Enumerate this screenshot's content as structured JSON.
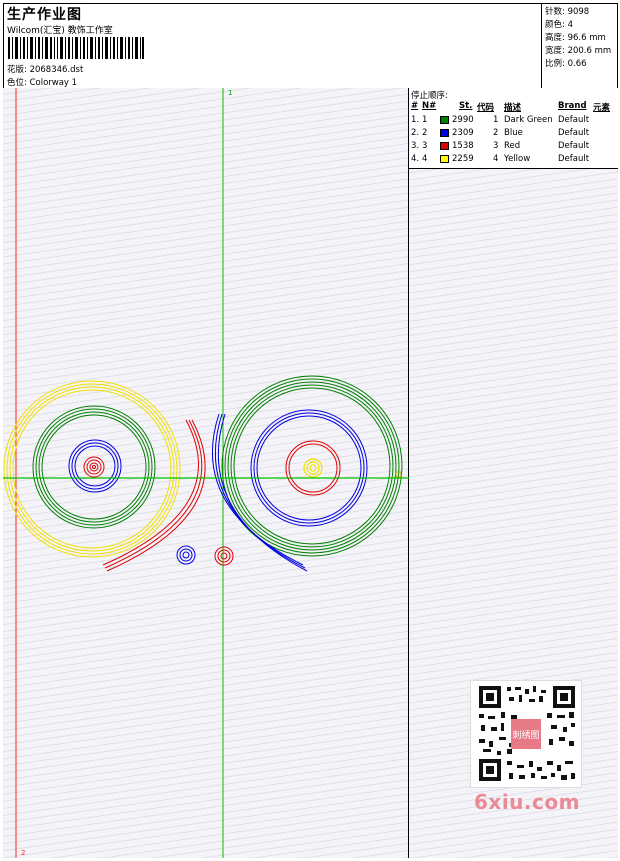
{
  "header": {
    "title": "生产作业图",
    "studio": "Wilcom(汇宝) 教饰工作室",
    "design_label": "花版:",
    "design_value": "2068346.dst",
    "colorway_label": "色位:",
    "colorway_value": "Colorway 1"
  },
  "specs": [
    {
      "label": "针数:",
      "value": "9098"
    },
    {
      "label": "颜色:",
      "value": "4"
    },
    {
      "label": "高度:",
      "value": "96.6 mm"
    },
    {
      "label": "宽度:",
      "value": "200.6 mm"
    },
    {
      "label": "比例:",
      "value": "0.66"
    }
  ],
  "canvas": {
    "guide_v1_label": "1",
    "guide_v2_label": "2",
    "guide_color_green": "#00c000",
    "guide_color_red": "#ff2020"
  },
  "stop_sequence": {
    "title": "停止顺序:",
    "headers": [
      "#",
      "N#",
      "St.",
      "代码",
      "描述",
      "Brand",
      "元素"
    ],
    "rows": [
      {
        "num": "1.",
        "n": "1",
        "color": "#008000",
        "st": "2990",
        "code": "1",
        "desc": "Dark Green",
        "brand": "Default"
      },
      {
        "num": "2.",
        "n": "2",
        "color": "#0000e0",
        "st": "2309",
        "code": "2",
        "desc": "Blue",
        "brand": "Default"
      },
      {
        "num": "3.",
        "n": "3",
        "color": "#e00000",
        "st": "1538",
        "code": "3",
        "desc": "Red",
        "brand": "Default"
      },
      {
        "num": "4.",
        "n": "4",
        "color": "#ffff00",
        "st": "2259",
        "code": "4",
        "desc": "Yellow",
        "brand": "Default"
      }
    ]
  },
  "watermark": {
    "text": "6xiu.com",
    "stamp": "刺绣图"
  }
}
